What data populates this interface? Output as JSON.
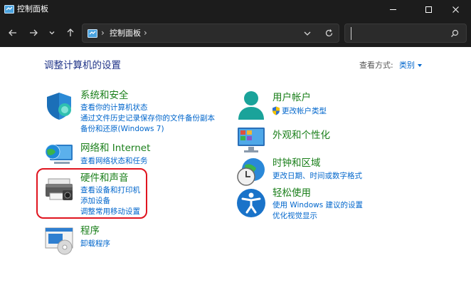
{
  "window": {
    "title": "控制面板"
  },
  "address_bar": {
    "path": "控制面板"
  },
  "search": {
    "placeholder": ""
  },
  "header": {
    "title": "调整计算机的设置",
    "view_by_label": "查看方式:",
    "view_by_value": "类别"
  },
  "categories_left": [
    {
      "title": "系统和安全",
      "icon": "shield-icon",
      "links": [
        "查看你的计算机状态",
        "通过文件历史记录保存你的文件备份副本",
        "备份和还原(Windows 7)"
      ]
    },
    {
      "title": "网络和 Internet",
      "icon": "network-globe-icon",
      "links": [
        "查看网络状态和任务"
      ]
    },
    {
      "title": "硬件和声音",
      "icon": "printer-icon",
      "links": [
        "查看设备和打印机",
        "添加设备",
        "调整常用移动设置"
      ]
    },
    {
      "title": "程序",
      "icon": "programs-disc-icon",
      "links": [
        "卸载程序"
      ]
    }
  ],
  "categories_right": [
    {
      "title": "用户帐户",
      "icon": "user-icon",
      "links": [
        "更改帐户类型"
      ]
    },
    {
      "title": "外观和个性化",
      "icon": "monitor-palette-icon",
      "links": []
    },
    {
      "title": "时钟和区域",
      "icon": "clock-globe-icon",
      "links": [
        "更改日期、时间或数字格式"
      ]
    },
    {
      "title": "轻松使用",
      "icon": "accessibility-icon",
      "links": [
        "使用 Windows 建议的设置",
        "优化视觉显示"
      ]
    }
  ],
  "colors": {
    "titlebar_bg": "#1c1c1c",
    "category_title": "#1a7f1a",
    "link": "#0066cc",
    "highlight": "#e0141f"
  }
}
